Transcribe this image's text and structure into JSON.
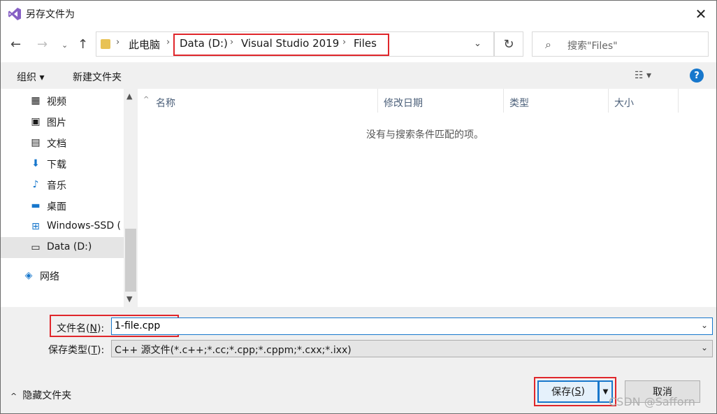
{
  "window": {
    "title": "另存文件为",
    "close_glyph": "✕"
  },
  "nav": {
    "back": "←",
    "forward": "→",
    "recent": "⌄",
    "up": "↑",
    "refresh": "↻"
  },
  "address": {
    "segments": [
      "此电脑",
      "Data (D:)",
      "Visual Studio 2019",
      "Files"
    ],
    "separator": "›",
    "dropdown": "⌄"
  },
  "search": {
    "placeholder": "搜索\"Files\"",
    "icon": "⌕"
  },
  "toolbar": {
    "organize": "组织 ▾",
    "new_folder": "新建文件夹",
    "view": "☷ ▾",
    "help": "?"
  },
  "navpane": {
    "items": [
      {
        "label": "视频",
        "icon": "▦"
      },
      {
        "label": "图片",
        "icon": "▣"
      },
      {
        "label": "文档",
        "icon": "▤"
      },
      {
        "label": "下载",
        "icon": "⬇"
      },
      {
        "label": "音乐",
        "icon": "♪"
      },
      {
        "label": "桌面",
        "icon": "▬"
      },
      {
        "label": "Windows-SSD (",
        "icon": "⊞"
      },
      {
        "label": "Data (D:)",
        "icon": "▭"
      },
      {
        "label": "网络",
        "icon": "◈"
      }
    ],
    "scroll_up": "▲",
    "scroll_down": "▼"
  },
  "filelist": {
    "columns": [
      "名称",
      "修改日期",
      "类型",
      "大小"
    ],
    "sort_arrow": "^",
    "empty_message": "没有与搜索条件匹配的项。"
  },
  "filename": {
    "label_pre": "文件名(",
    "label_key": "N",
    "label_post": "):",
    "value": "1-file.cpp",
    "dropdown": "⌄"
  },
  "filetype": {
    "label_pre": "保存类型(",
    "label_key": "T",
    "label_post": "):",
    "value": "C++ 源文件(*.c++;*.cc;*.cpp;*.cppm;*.cxx;*.ixx)",
    "dropdown": "⌄"
  },
  "footer": {
    "hide_folders": "隐藏文件夹",
    "hide_chevron": "^",
    "save_pre": "保存(",
    "save_key": "S",
    "save_post": ")",
    "save_split": "▼",
    "cancel": "取消"
  },
  "watermark": "CSDN @Safforn",
  "colors": {
    "highlight": "#e0262b",
    "accent": "#1777cc"
  }
}
